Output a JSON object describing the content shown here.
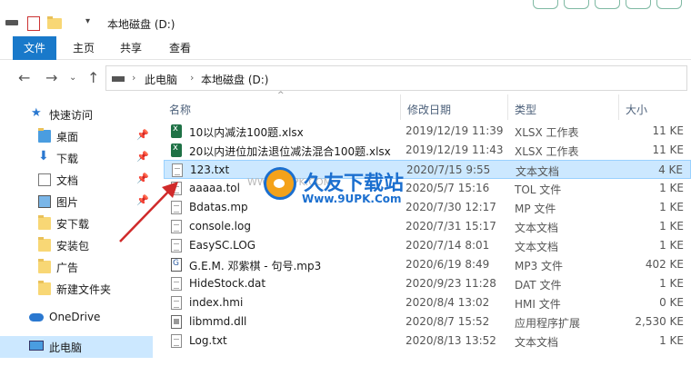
{
  "titlebar": {
    "title": "本地磁盘 (D:)"
  },
  "ribbon": {
    "tabs": [
      "文件",
      "主页",
      "共享",
      "查看"
    ]
  },
  "address": {
    "crumbs": [
      "此电脑",
      "本地磁盘 (D:)"
    ]
  },
  "nav": {
    "quick_access": "快速访问",
    "items": [
      {
        "label": "桌面",
        "icon": "desktop-folder-icon",
        "pinned": true
      },
      {
        "label": "下载",
        "icon": "download-icon",
        "pinned": true
      },
      {
        "label": "文档",
        "icon": "documents-icon",
        "pinned": true
      },
      {
        "label": "图片",
        "icon": "pictures-icon",
        "pinned": true
      },
      {
        "label": "安下载",
        "icon": "folder-icon",
        "pinned": false
      },
      {
        "label": "安装包",
        "icon": "folder-icon",
        "pinned": false
      },
      {
        "label": "广告",
        "icon": "folder-icon",
        "pinned": false
      },
      {
        "label": "新建文件夹",
        "icon": "folder-icon",
        "pinned": false
      }
    ],
    "onedrive": "OneDrive",
    "this_pc": "此电脑"
  },
  "columns": {
    "name": "名称",
    "date": "修改日期",
    "type": "类型",
    "size": "大小"
  },
  "files": [
    {
      "name": "10以内减法100题.xlsx",
      "date": "2019/12/19 11:39",
      "type": "XLSX 工作表",
      "size": "11 KE",
      "icon": "xlsx"
    },
    {
      "name": "20以内进位加法退位减法混合100题.xlsx",
      "date": "2019/12/19 11:43",
      "type": "XLSX 工作表",
      "size": "11 KE",
      "icon": "xlsx"
    },
    {
      "name": "123.txt",
      "date": "2020/7/15 9:55",
      "type": "文本文档",
      "size": "4 KE",
      "icon": "txt",
      "selected": true
    },
    {
      "name": "aaaaa.tol",
      "date": "2020/5/7 15:16",
      "type": "TOL 文件",
      "size": "1 KE",
      "icon": "txt"
    },
    {
      "name": "Bdatas.mp",
      "date": "2020/7/30 12:17",
      "type": "MP 文件",
      "size": "1 KE",
      "icon": "txt"
    },
    {
      "name": "console.log",
      "date": "2020/7/31 15:17",
      "type": "文本文档",
      "size": "1 KE",
      "icon": "txt"
    },
    {
      "name": "EasySC.LOG",
      "date": "2020/7/14 8:01",
      "type": "文本文档",
      "size": "1 KE",
      "icon": "txt"
    },
    {
      "name": "G.E.M. 邓紫棋 - 句号.mp3",
      "date": "2020/6/19 8:49",
      "type": "MP3 文件",
      "size": "402 KE",
      "icon": "mp3"
    },
    {
      "name": "HideStock.dat",
      "date": "2020/9/23 11:28",
      "type": "DAT 文件",
      "size": "1 KE",
      "icon": "txt"
    },
    {
      "name": "index.hmi",
      "date": "2020/8/4 13:02",
      "type": "HMI 文件",
      "size": "0 KE",
      "icon": "txt"
    },
    {
      "name": "libmmd.dll",
      "date": "2020/8/7 15:52",
      "type": "应用程序扩展",
      "size": "2,530 KE",
      "icon": "dll"
    },
    {
      "name": "Log.txt",
      "date": "2020/8/13 13:52",
      "type": "文本文档",
      "size": "1 KE",
      "icon": "txt"
    }
  ],
  "watermark": {
    "brand": "久友下载站",
    "url": "Www.9UPK.Com",
    "faint": "WWW.9UPK.COM"
  },
  "colors": {
    "accent": "#1979ca",
    "selection": "#cce8ff",
    "arrow": "#d02a2a"
  }
}
